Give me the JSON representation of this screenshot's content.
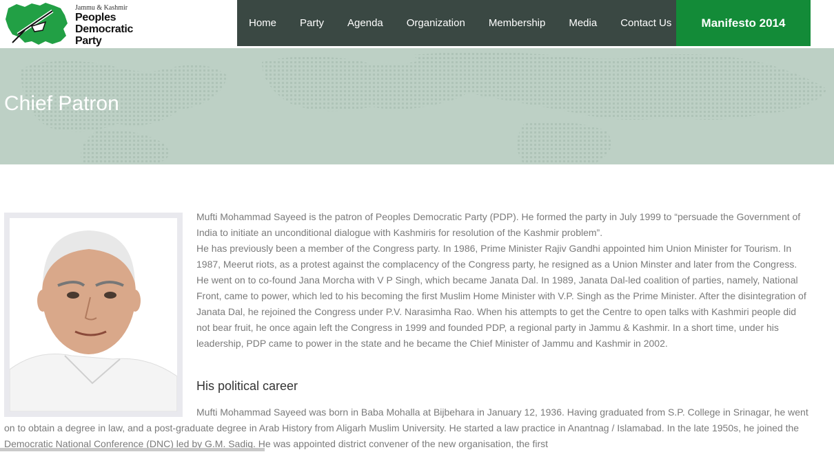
{
  "brand": {
    "small_line": "Jammu & Kashmir",
    "name_line1": "Peoples",
    "name_line2": "Democratic",
    "name_line3": "Party"
  },
  "nav": {
    "items": [
      {
        "label": "Home"
      },
      {
        "label": "Party"
      },
      {
        "label": "Agenda"
      },
      {
        "label": "Organization"
      },
      {
        "label": "Membership"
      },
      {
        "label": "Media"
      },
      {
        "label": "Contact Us"
      }
    ],
    "manifesto_label": "Manifesto 2014"
  },
  "hero": {
    "title": "Chief Patron"
  },
  "content": {
    "paragraph1": "Mufti Mohammad Sayeed is the patron of Peoples Democratic Party (PDP). He formed the party in July 1999 to “persuade the Government of India to initiate an unconditional dialogue with Kashmiris for resolution of the Kashmir problem”.",
    "paragraph2": "He has previously been a member of the Congress party. In 1986, Prime Minister Rajiv Gandhi appointed him Union Minister for Tourism. In 1987, Meerut riots, as a protest against the complacency of the Congress party, he resigned as a Union Minster and later from the Congress. He went on to co-found Jana Morcha with V P Singh, which became Janata Dal. In 1989, Janata Dal-led coalition of parties, namely, National Front, came to power, which led to his becoming the first Muslim Home Minister with V.P. Singh as the Prime Minister. After the disintegration of Janata Dal, he rejoined the Congress under P.V. Narasimha Rao. When his attempts to get the Centre to open talks with Kashmiri people did not bear fruit, he once again left the Congress in 1999 and founded PDP, a regional party in Jammu & Kashmir. In a short time, under his leadership, PDP came to power in the state and he became the Chief Minister of Jammu and Kashmir in 2002.",
    "heading": "His political career",
    "paragraph3": "Mufti Mohammad Sayeed was born in Baba Mohalla at Bijbehara in January 12, 1936. Having graduated from S.P. College in Srinagar, he went on to obtain a degree in law, and a post-graduate degree in Arab History from Aligarh Muslim University. He started a law practice in Anantnag / Islamabad. In the late 1950s, he joined the Democratic National Conference (DNC) led by G.M. Sadiq. He was appointed district convener of the new organisation, the first"
  },
  "colors": {
    "nav_bg": "#3a4843",
    "accent_green": "#138b38",
    "hero_bg": "#bdd0c5"
  }
}
